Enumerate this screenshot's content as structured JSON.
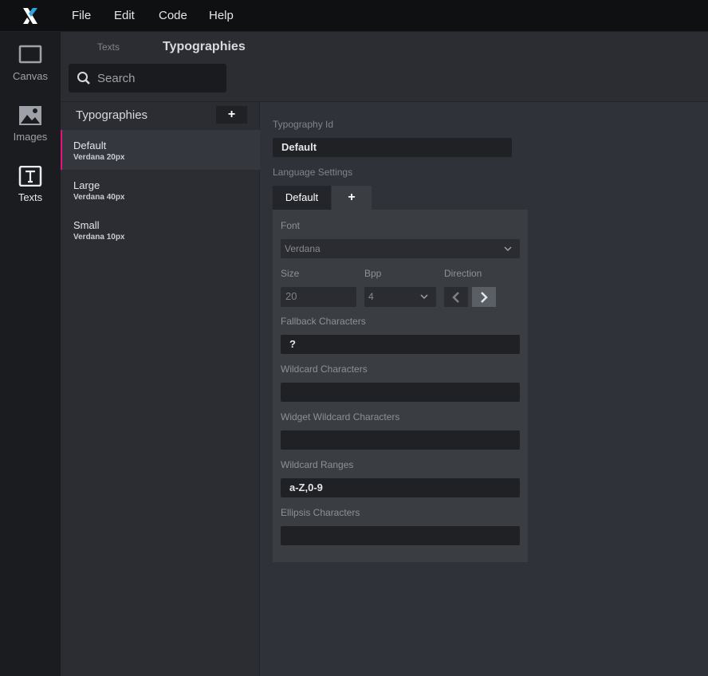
{
  "menu": {
    "file": "File",
    "edit": "Edit",
    "code": "Code",
    "help": "Help"
  },
  "rail": {
    "canvas": "Canvas",
    "images": "Images",
    "texts": "Texts"
  },
  "breadcrumb": {
    "parent": "Texts",
    "current": "Typographies"
  },
  "search": {
    "placeholder": "Search"
  },
  "list": {
    "title": "Typographies",
    "add": "+",
    "items": [
      {
        "name": "Default",
        "sub": "Verdana 20px"
      },
      {
        "name": "Large",
        "sub": "Verdana 40px"
      },
      {
        "name": "Small",
        "sub": "Verdana 10px"
      }
    ]
  },
  "detail": {
    "typography_id_label": "Typography Id",
    "typography_id_value": "Default",
    "language_settings_label": "Language Settings",
    "lang_tab": "Default",
    "lang_add": "+",
    "font_label": "Font",
    "font_value": "Verdana",
    "size_label": "Size",
    "size_value": "20",
    "bpp_label": "Bpp",
    "bpp_value": "4",
    "direction_label": "Direction",
    "fallback_label": "Fallback Characters",
    "fallback_value": "?",
    "wildcard_label": "Wildcard Characters",
    "wildcard_value": "",
    "widget_wildcard_label": "Widget Wildcard Characters",
    "widget_wildcard_value": "",
    "wildcard_ranges_label": "Wildcard Ranges",
    "wildcard_ranges_value": "a-Z,0-9",
    "ellipsis_label": "Ellipsis Characters",
    "ellipsis_value": ""
  },
  "colors": {
    "accent": "#e3127e",
    "logo_blue": "#2aa6e0"
  }
}
